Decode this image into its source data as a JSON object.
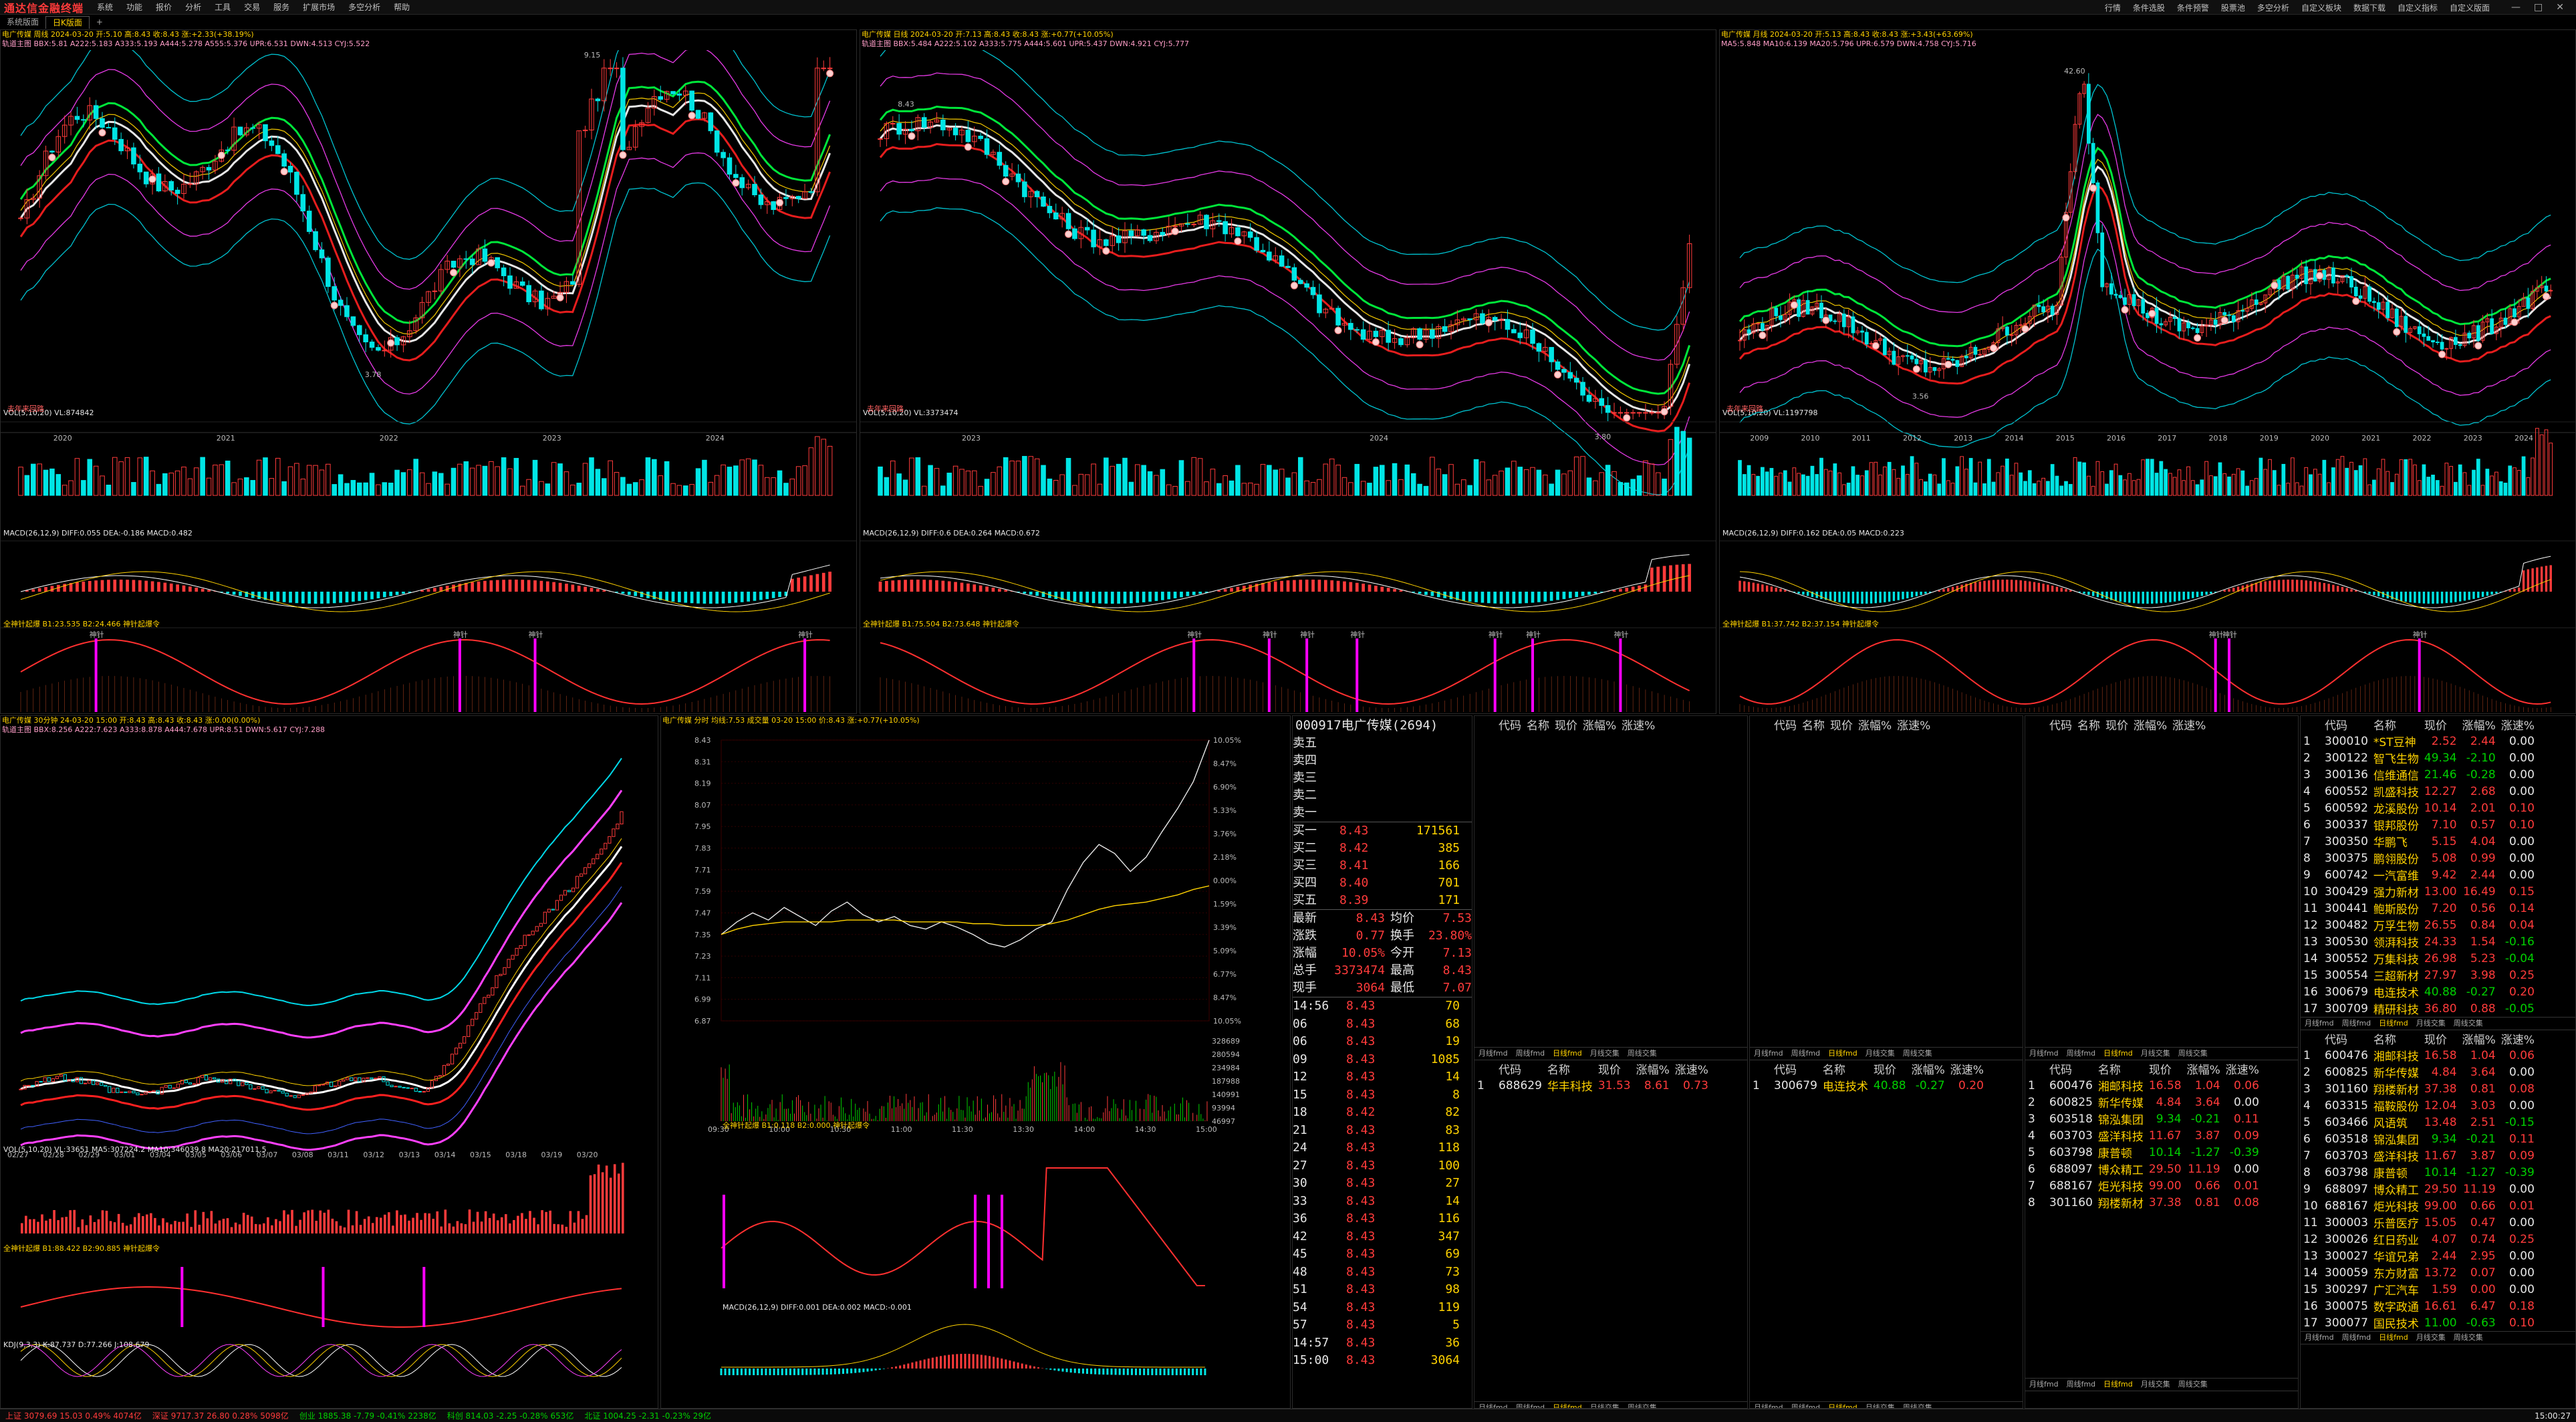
{
  "app": {
    "logo": "通达信金融终端",
    "menu": [
      "系统",
      "功能",
      "报价",
      "分析",
      "工具",
      "交易",
      "服务",
      "扩展市场",
      "多空分析",
      "帮助"
    ],
    "right_tools": [
      "行情",
      "条件选股",
      "条件预警",
      "股票池",
      "多空分析",
      "自定义板块",
      "数据下载",
      "自定义指标",
      "自定义版面"
    ],
    "tabs": [
      "系统版面",
      "日K版面",
      "+"
    ]
  },
  "stock": {
    "code": "000917",
    "name": "电广传媒",
    "quote_title": "000917电广传媒(2694)"
  },
  "panels": [
    {
      "title": "电广传媒 周线 2024-03-20 开:5.10 高:8.43 收:8.43 涨:+2.33(+38.19%)",
      "indicator": "轨道主图 BBX:5.81 A222:5.183 A333:5.193 A444:5.278 A555:5.376 UPR:6.531 DWN:4.513 CYJ:5.522",
      "years": [
        "2020",
        "2021",
        "2022",
        "2023",
        "2024"
      ],
      "high_label": "9.15",
      "low_label": "3.78",
      "left_note": "去年来回路"
    },
    {
      "title": "电广传媒 日线 2024-03-20 开:7.13 高:8.43 收:8.43 涨:+0.77(+10.05%)",
      "indicator": "轨道主图 BBX:5.484 A222:5.102 A333:5.775 A444:5.601 UPR:5.437 DWN:4.921 CYJ:5.777",
      "years": [
        "2023",
        "2024"
      ],
      "high_label": "8.43",
      "low_label": "3.80",
      "left_note": "去年来回路"
    },
    {
      "title": "电广传媒 月线 2024-03-20 开:5.13 高:8.43 收:8.43 涨:+3.43(+63.69%)",
      "indicator": "MA5:5.848 MA10:6.139 MA20:5.796 UPR:6.579 DWN:4.758 CYJ:5.716",
      "years": [
        "2009",
        "2010",
        "2011",
        "2012",
        "2013",
        "2014",
        "2015",
        "2016",
        "2017",
        "2018",
        "2019",
        "2020",
        "2021",
        "2022",
        "2023",
        "2024"
      ],
      "high_label": "42.60",
      "low_label": "3.56",
      "left_note": "去年来回路"
    }
  ],
  "sub_labels": {
    "vol": [
      "VOL(5,10,20) VL:874842",
      "VOL(5,10,20) VL:3373474",
      "VOL(5,10,20) VL:1197798"
    ],
    "macd": [
      "MACD(26,12,9) DIFF:0.055 DEA:-0.186 MACD:0.482",
      "MACD(26,12,9) DIFF:0.6 DEA:0.264 MACD:0.672",
      "MACD(26,12,9) DIFF:0.162 DEA:0.05 MACD:0.223"
    ],
    "shenzhen": [
      "全神针起爆 B1:23.535 B2:24.466 神针起爆令",
      "全神针起爆 B1:75.504 B2:73.648 神针起爆令",
      "全神针起爆 B1:37.742 B2:37.154 神针起爆令"
    ],
    "shenzhen_tag": "神针"
  },
  "intraday_title": "电广传媒 30分钟 24-03-20 15:00 开:8.43 高:8.43 收:8.43 涨:0.00(0.00%)",
  "intraday_indicator": "轨道主图 BBX:8.256 A222:7.623 A333:8.878 A444:7.678 UPR:8.51 DWN:5.617 CYJ:7.288",
  "intraday_dates": [
    "02/27",
    "02/28",
    "02/29",
    "03/01",
    "03/04",
    "03/05",
    "03/06",
    "03/07",
    "03/08",
    "03/11",
    "03/12",
    "03/13",
    "03/14",
    "03/15",
    "03/18",
    "03/19",
    "03/20"
  ],
  "intraday_vol": "VOL(5,10,20) VL:33651 MA5:307224.2 MA10:346039.8 MA20:217011.5",
  "intraday_kdj": "KDJ(9,3,3) K:87.737 D:77.266 J:108.679",
  "intraday_shenzhen": "全神针起爆 B1:88.422 B2:90.885 神针起爆令",
  "timeshare": {
    "title": "电广传媒 分时 均线:7.53 成交量 03-20 15:00 价:8.43 涨:+0.77(+10.05%)",
    "price_ticks": [
      "8.43",
      "8.31",
      "8.19",
      "8.07",
      "7.95",
      "7.83",
      "7.71",
      "7.59",
      "7.47",
      "7.35",
      "7.23",
      "7.11",
      "6.99",
      "6.87"
    ],
    "pct_ticks": [
      "10.05%",
      "8.47%",
      "6.90%",
      "5.33%",
      "3.76%",
      "2.18%",
      "0.00%",
      "1.59%",
      "3.39%",
      "5.09%",
      "6.77%",
      "8.47%",
      "10.05%"
    ],
    "vol_ticks": [
      "328689",
      "280594",
      "234984",
      "187988",
      "140991",
      "93994",
      "46997"
    ],
    "times": [
      "09:30",
      "10:00",
      "10:30",
      "11:00",
      "11:30",
      "13:30",
      "14:00",
      "14:30",
      "15:00"
    ],
    "series": [
      7.35,
      7.42,
      7.47,
      7.43,
      7.5,
      7.45,
      7.4,
      7.48,
      7.53,
      7.46,
      7.42,
      7.45,
      7.4,
      7.38,
      7.42,
      7.39,
      7.35,
      7.3,
      7.28,
      7.32,
      7.38,
      7.42,
      7.6,
      7.75,
      7.85,
      7.8,
      7.7,
      7.78,
      7.92,
      8.05,
      8.2,
      8.43
    ],
    "avg_series": [
      7.35,
      7.38,
      7.4,
      7.41,
      7.42,
      7.42,
      7.42,
      7.42,
      7.43,
      7.43,
      7.43,
      7.43,
      7.42,
      7.42,
      7.42,
      7.42,
      7.41,
      7.41,
      7.4,
      7.4,
      7.4,
      7.41,
      7.43,
      7.46,
      7.49,
      7.51,
      7.52,
      7.53,
      7.55,
      7.57,
      7.6,
      7.62
    ],
    "macd_label": "MACD(26,12,9) DIFF:0.001 DEA:0.002 MACD:-0.001",
    "shenzhen_label": "全神针起爆 B1:0.118 B2:0.000 神针起爆令"
  },
  "orderbook": {
    "sell": [
      {
        "l": "卖五",
        "p": "",
        "v": ""
      },
      {
        "l": "卖四",
        "p": "",
        "v": ""
      },
      {
        "l": "卖三",
        "p": "",
        "v": ""
      },
      {
        "l": "卖二",
        "p": "",
        "v": ""
      },
      {
        "l": "卖一",
        "p": "",
        "v": ""
      }
    ],
    "buy": [
      {
        "l": "买一",
        "p": "8.43",
        "v": "171561"
      },
      {
        "l": "买二",
        "p": "8.42",
        "v": "385"
      },
      {
        "l": "买三",
        "p": "8.41",
        "v": "166"
      },
      {
        "l": "买四",
        "p": "8.40",
        "v": "701"
      },
      {
        "l": "买五",
        "p": "8.39",
        "v": "171"
      }
    ],
    "stats": [
      {
        "a": "最新",
        "av": "8.43",
        "b": "均价",
        "bv": "7.53"
      },
      {
        "a": "涨跌",
        "av": "0.77",
        "b": "换手",
        "bv": "23.80%"
      },
      {
        "a": "涨幅",
        "av": "10.05%",
        "b": "今开",
        "bv": "7.13"
      },
      {
        "a": "总手",
        "av": "3373474",
        "b": "最高",
        "bv": "8.43"
      },
      {
        "a": "现手",
        "av": "3064",
        "b": "最低",
        "bv": "7.07"
      }
    ],
    "ticks": [
      {
        "t": "14:56",
        "p": "8.43",
        "v": "70"
      },
      {
        "t": "06",
        "p": "8.43",
        "v": "68"
      },
      {
        "t": "06",
        "p": "8.43",
        "v": "19"
      },
      {
        "t": "09",
        "p": "8.43",
        "v": "1085"
      },
      {
        "t": "12",
        "p": "8.43",
        "v": "14"
      },
      {
        "t": "15",
        "p": "8.43",
        "v": "8"
      },
      {
        "t": "18",
        "p": "8.42",
        "v": "82"
      },
      {
        "t": "21",
        "p": "8.43",
        "v": "83"
      },
      {
        "t": "24",
        "p": "8.43",
        "v": "118"
      },
      {
        "t": "27",
        "p": "8.43",
        "v": "100"
      },
      {
        "t": "30",
        "p": "8.43",
        "v": "27"
      },
      {
        "t": "33",
        "p": "8.43",
        "v": "14"
      },
      {
        "t": "36",
        "p": "8.43",
        "v": "116"
      },
      {
        "t": "42",
        "p": "8.43",
        "v": "347"
      },
      {
        "t": "45",
        "p": "8.43",
        "v": "69"
      },
      {
        "t": "48",
        "p": "8.43",
        "v": "73"
      },
      {
        "t": "51",
        "p": "8.43",
        "v": "98"
      },
      {
        "t": "54",
        "p": "8.43",
        "v": "119"
      },
      {
        "t": "57",
        "p": "8.43",
        "v": "5"
      },
      {
        "t": "14:57",
        "p": "8.43",
        "v": "36"
      },
      {
        "t": "15:00",
        "p": "8.43",
        "v": "3064"
      }
    ]
  },
  "rank_headers": [
    "代码",
    "名称",
    "现价",
    "涨幅%",
    "涨速%"
  ],
  "rank_tabs": [
    "月线fmd",
    "周线fmd",
    "日线fmd",
    "月线交集",
    "周线交集"
  ],
  "mid_rank_a": [
    {
      "i": "1",
      "c": "688629",
      "n": "华丰科技",
      "p": "31.53",
      "z": "8.61",
      "s": "0.73"
    }
  ],
  "mid_rank_b": [
    {
      "i": "1",
      "c": "300679",
      "n": "电连技术",
      "p": "40.88",
      "z": "-0.27",
      "s": "0.20"
    }
  ],
  "rank_small": [
    {
      "i": "1",
      "c": "600476",
      "n": "湘邮科技",
      "p": "16.58",
      "z": "1.04",
      "s": "0.06"
    },
    {
      "i": "2",
      "c": "600825",
      "n": "新华传媒",
      "p": "4.84",
      "z": "3.64",
      "s": "0.00"
    },
    {
      "i": "3",
      "c": "603518",
      "n": "锦泓集团",
      "p": "9.34",
      "z": "-0.21",
      "s": "0.11"
    },
    {
      "i": "4",
      "c": "603703",
      "n": "盛洋科技",
      "p": "11.67",
      "z": "3.87",
      "s": "0.09"
    },
    {
      "i": "5",
      "c": "603798",
      "n": "康普顿",
      "p": "10.14",
      "z": "-1.27",
      "s": "-0.39"
    },
    {
      "i": "6",
      "c": "688097",
      "n": "博众精工",
      "p": "29.50",
      "z": "11.19",
      "s": "0.00"
    },
    {
      "i": "7",
      "c": "688167",
      "n": "炬光科技",
      "p": "99.00",
      "z": "0.66",
      "s": "0.01"
    },
    {
      "i": "8",
      "c": "301160",
      "n": "翔楼新材",
      "p": "37.38",
      "z": "0.81",
      "s": "0.08"
    }
  ],
  "rank_top": [
    {
      "i": "1",
      "c": "300010",
      "n": "*ST豆神",
      "p": "2.52",
      "z": "2.44",
      "s": "0.00"
    },
    {
      "i": "2",
      "c": "300122",
      "n": "智飞生物",
      "p": "49.34",
      "z": "-2.10",
      "s": "0.00"
    },
    {
      "i": "3",
      "c": "300136",
      "n": "信维通信",
      "p": "21.46",
      "z": "-0.28",
      "s": "0.00"
    },
    {
      "i": "4",
      "c": "600552",
      "n": "凯盛科技",
      "p": "12.27",
      "z": "2.68",
      "s": "0.00"
    },
    {
      "i": "5",
      "c": "600592",
      "n": "龙溪股份",
      "p": "10.14",
      "z": "2.01",
      "s": "0.10"
    },
    {
      "i": "6",
      "c": "300337",
      "n": "银邦股份",
      "p": "7.10",
      "z": "0.57",
      "s": "0.10"
    },
    {
      "i": "7",
      "c": "300350",
      "n": "华鹏飞",
      "p": "5.15",
      "z": "4.04",
      "s": "0.00"
    },
    {
      "i": "8",
      "c": "300375",
      "n": "鹏翎股份",
      "p": "5.08",
      "z": "0.99",
      "s": "0.00"
    },
    {
      "i": "9",
      "c": "600742",
      "n": "一汽富维",
      "p": "9.42",
      "z": "2.44",
      "s": "0.00"
    },
    {
      "i": "10",
      "c": "300429",
      "n": "强力新材",
      "p": "13.00",
      "z": "16.49",
      "s": "0.15"
    },
    {
      "i": "11",
      "c": "300441",
      "n": "鲍斯股份",
      "p": "7.20",
      "z": "0.56",
      "s": "0.14"
    },
    {
      "i": "12",
      "c": "300482",
      "n": "万孚生物",
      "p": "26.55",
      "z": "0.84",
      "s": "0.04"
    },
    {
      "i": "13",
      "c": "300530",
      "n": "领湃科技",
      "p": "24.33",
      "z": "1.54",
      "s": "-0.16"
    },
    {
      "i": "14",
      "c": "300552",
      "n": "万集科技",
      "p": "26.98",
      "z": "5.23",
      "s": "-0.04"
    },
    {
      "i": "15",
      "c": "300554",
      "n": "三超新材",
      "p": "27.97",
      "z": "3.98",
      "s": "0.25"
    },
    {
      "i": "16",
      "c": "300679",
      "n": "电连技术",
      "p": "40.88",
      "z": "-0.27",
      "s": "0.20"
    },
    {
      "i": "17",
      "c": "300709",
      "n": "精研科技",
      "p": "36.80",
      "z": "0.88",
      "s": "-0.05"
    }
  ],
  "rank_bottom": [
    {
      "i": "1",
      "c": "600476",
      "n": "湘邮科技",
      "p": "16.58",
      "z": "1.04",
      "s": "0.06"
    },
    {
      "i": "2",
      "c": "600825",
      "n": "新华传媒",
      "p": "4.84",
      "z": "3.64",
      "s": "0.00"
    },
    {
      "i": "3",
      "c": "301160",
      "n": "翔楼新材",
      "p": "37.38",
      "z": "0.81",
      "s": "0.08"
    },
    {
      "i": "4",
      "c": "603315",
      "n": "福鞍股份",
      "p": "12.04",
      "z": "3.03",
      "s": "0.00"
    },
    {
      "i": "5",
      "c": "603466",
      "n": "风语筑",
      "p": "13.48",
      "z": "2.51",
      "s": "-0.15"
    },
    {
      "i": "6",
      "c": "603518",
      "n": "锦泓集团",
      "p": "9.34",
      "z": "-0.21",
      "s": "0.11"
    },
    {
      "i": "7",
      "c": "603703",
      "n": "盛洋科技",
      "p": "11.67",
      "z": "3.87",
      "s": "0.09"
    },
    {
      "i": "8",
      "c": "603798",
      "n": "康普顿",
      "p": "10.14",
      "z": "-1.27",
      "s": "-0.39"
    },
    {
      "i": "9",
      "c": "688097",
      "n": "博众精工",
      "p": "29.50",
      "z": "11.19",
      "s": "0.00"
    },
    {
      "i": "10",
      "c": "688167",
      "n": "炬光科技",
      "p": "99.00",
      "z": "0.66",
      "s": "0.01"
    },
    {
      "i": "11",
      "c": "300003",
      "n": "乐普医疗",
      "p": "15.05",
      "z": "0.47",
      "s": "0.00"
    },
    {
      "i": "12",
      "c": "300026",
      "n": "红日药业",
      "p": "4.07",
      "z": "0.74",
      "s": "0.25"
    },
    {
      "i": "13",
      "c": "300027",
      "n": "华谊兄弟",
      "p": "2.44",
      "z": "2.95",
      "s": "0.00"
    },
    {
      "i": "14",
      "c": "300059",
      "n": "东方财富",
      "p": "13.72",
      "z": "0.07",
      "s": "0.00"
    },
    {
      "i": "15",
      "c": "300297",
      "n": "广汇汽车",
      "p": "1.59",
      "z": "0.00",
      "s": "0.00"
    },
    {
      "i": "16",
      "c": "300075",
      "n": "数字政通",
      "p": "16.61",
      "z": "6.47",
      "s": "0.18"
    },
    {
      "i": "17",
      "c": "300077",
      "n": "国民技术",
      "p": "11.00",
      "z": "-0.63",
      "s": "0.10"
    }
  ],
  "statusbar": [
    "上证 3079.69 15.03 0.49% 4074亿",
    "深证 9717.37 26.80 0.28% 5098亿",
    "创业 1885.38 -7.79 -0.41% 2238亿",
    "科创 814.03 -2.25 -0.28% 653亿",
    "北证 1004.25 -2.31 -0.23% 29亿",
    "15:00:27"
  ],
  "colors": {
    "up": "#ff3b3b",
    "down": "#00d000",
    "accent": "#ffd200",
    "cyan": "#00e5e5",
    "magenta": "#ff40ff"
  }
}
